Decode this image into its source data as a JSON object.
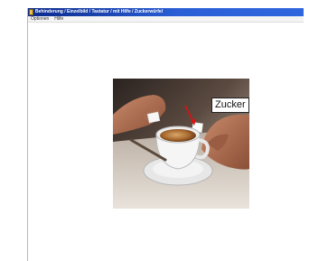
{
  "window": {
    "title": "Behinderung / Einzelbild / Tastatur / mit Hilfe / Zuckerwürfel",
    "menu": [
      "Optionen",
      "Hilfe"
    ]
  },
  "photo": {
    "annotation": "Zucker",
    "arrow_color": "#e01010"
  }
}
